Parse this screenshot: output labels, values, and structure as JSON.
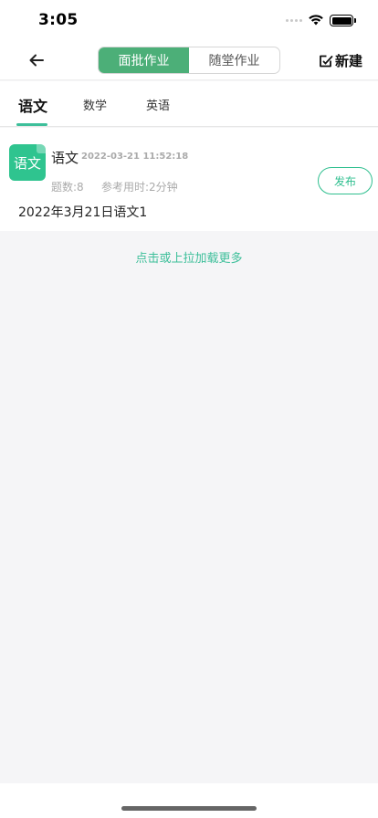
{
  "status_bar": {
    "time": "3:05"
  },
  "nav": {
    "segments": [
      "面批作业",
      "随堂作业"
    ],
    "active_segment": 0,
    "new_label": "新建"
  },
  "subject_tabs": [
    "语文",
    "数学",
    "英语"
  ],
  "homework": [
    {
      "icon_text": "语文",
      "title": "语文",
      "time": "2022-03-21 11:52:18",
      "count": "题数:8",
      "duration": "参考用时:2分钟",
      "description": "2022年3月21日语文1",
      "action": "发布"
    }
  ],
  "load_more": "点击或上拉加载更多",
  "colors": {
    "accent": "#4caf78",
    "green": "#2fc48f",
    "link": "#3dbf9a"
  }
}
